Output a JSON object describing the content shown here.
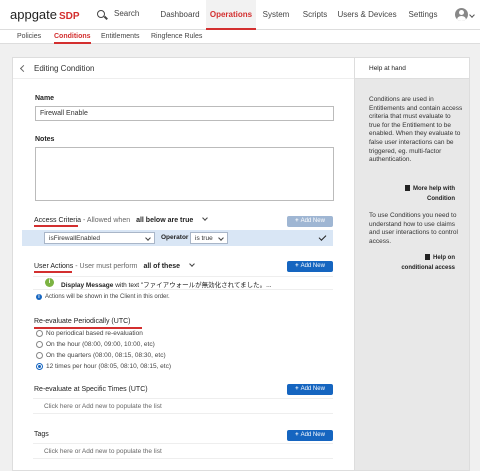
{
  "header": {
    "logo_main": "appgate",
    "logo_sdp": "SDP",
    "search_label": "Search",
    "nav": [
      "Dashboard",
      "Operations",
      "System",
      "Scripts",
      "Users & Devices",
      "Settings"
    ],
    "active_nav": "Operations"
  },
  "subnav": {
    "items": [
      "Policies",
      "Conditions",
      "Entitlements",
      "Ringfence Rules"
    ],
    "active": "Conditions"
  },
  "panel": {
    "title": "Editing Condition",
    "name_label": "Name",
    "name_value": "Firewall Enable",
    "notes_label": "Notes",
    "notes_value": "",
    "access": {
      "title": "Access Criteria",
      "allowed_prefix": "- Allowed when",
      "allowed_value": "all below are true",
      "add_label": "Add New",
      "criteria_value": "isFirewallEnabled",
      "operator_label": "Operator",
      "operator_value": "is true"
    },
    "actions": {
      "title": "User Actions",
      "perform_prefix": "- User must perform",
      "perform_value": "all of these",
      "add_label": "Add New",
      "action_type": "Display Message",
      "action_text": "with text \"ファイアウォールが無効化されてました。...",
      "note": "Actions will be shown in the Client in this order."
    },
    "reeval": {
      "title": "Re-evaluate Periodically (UTC)",
      "options": [
        "No periodical based re-evaluation",
        "On the hour (08:00, 09:00, 10:00, etc)",
        "On the quarters (08:00, 08:15, 08:30, etc)",
        "12 times per hour (08:05, 08:10, 08:15, etc)"
      ],
      "selected_index": 3
    },
    "specific": {
      "title": "Re-evaluate at Specific Times (UTC)",
      "add_label": "Add New",
      "placeholder": "Click here or Add new to populate the list"
    },
    "tags": {
      "title": "Tags",
      "add_label": "Add New",
      "placeholder": "Click here or Add new to populate the list"
    }
  },
  "help": {
    "title": "Help at hand",
    "text1": "Conditions are used in Entitlements and contain access criteria that must evaluate to true for the Entitlement to be enabled. When they evaluate to false user interactions can be triggered, eg. multi-factor authentication.",
    "link1": "More help with Condition",
    "text2": "To use Conditions you need to understand how to use claims and user interactions to control access.",
    "link2": "Help on conditional access"
  },
  "colors": {
    "accent": "#d32f2f",
    "primary": "#1565c0"
  }
}
